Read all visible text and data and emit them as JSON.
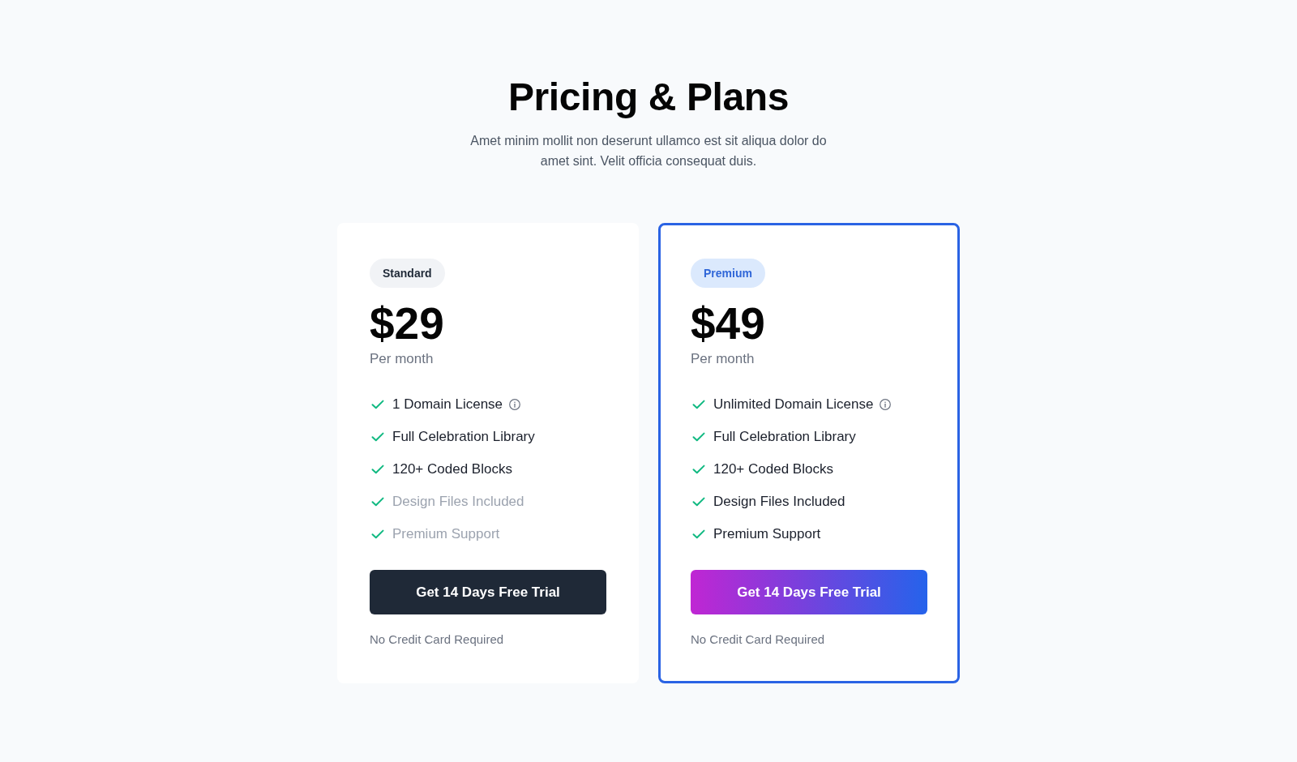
{
  "header": {
    "title": "Pricing & Plans",
    "subtitle": "Amet minim mollit non deserunt ullamco est sit aliqua dolor do amet sint. Velit officia consequat duis."
  },
  "plans": [
    {
      "badge": "Standard",
      "featured": false,
      "price": "$29",
      "period": "Per month",
      "features": [
        {
          "label": "1 Domain License",
          "disabled": false,
          "has_info": true
        },
        {
          "label": "Full Celebration Library",
          "disabled": false,
          "has_info": false
        },
        {
          "label": "120+ Coded Blocks",
          "disabled": false,
          "has_info": false
        },
        {
          "label": "Design Files Included",
          "disabled": true,
          "has_info": false
        },
        {
          "label": "Premium Support",
          "disabled": true,
          "has_info": false
        }
      ],
      "button": "Get 14 Days Free Trial",
      "note": "No Credit Card Required"
    },
    {
      "badge": "Premium",
      "featured": true,
      "price": "$49",
      "period": "Per month",
      "features": [
        {
          "label": "Unlimited Domain License",
          "disabled": false,
          "has_info": true
        },
        {
          "label": "Full Celebration Library",
          "disabled": false,
          "has_info": false
        },
        {
          "label": "120+ Coded Blocks",
          "disabled": false,
          "has_info": false
        },
        {
          "label": "Design Files Included",
          "disabled": false,
          "has_info": false
        },
        {
          "label": "Premium Support",
          "disabled": false,
          "has_info": false
        }
      ],
      "button": "Get 14 Days Free Trial",
      "note": "No Credit Card Required"
    }
  ]
}
